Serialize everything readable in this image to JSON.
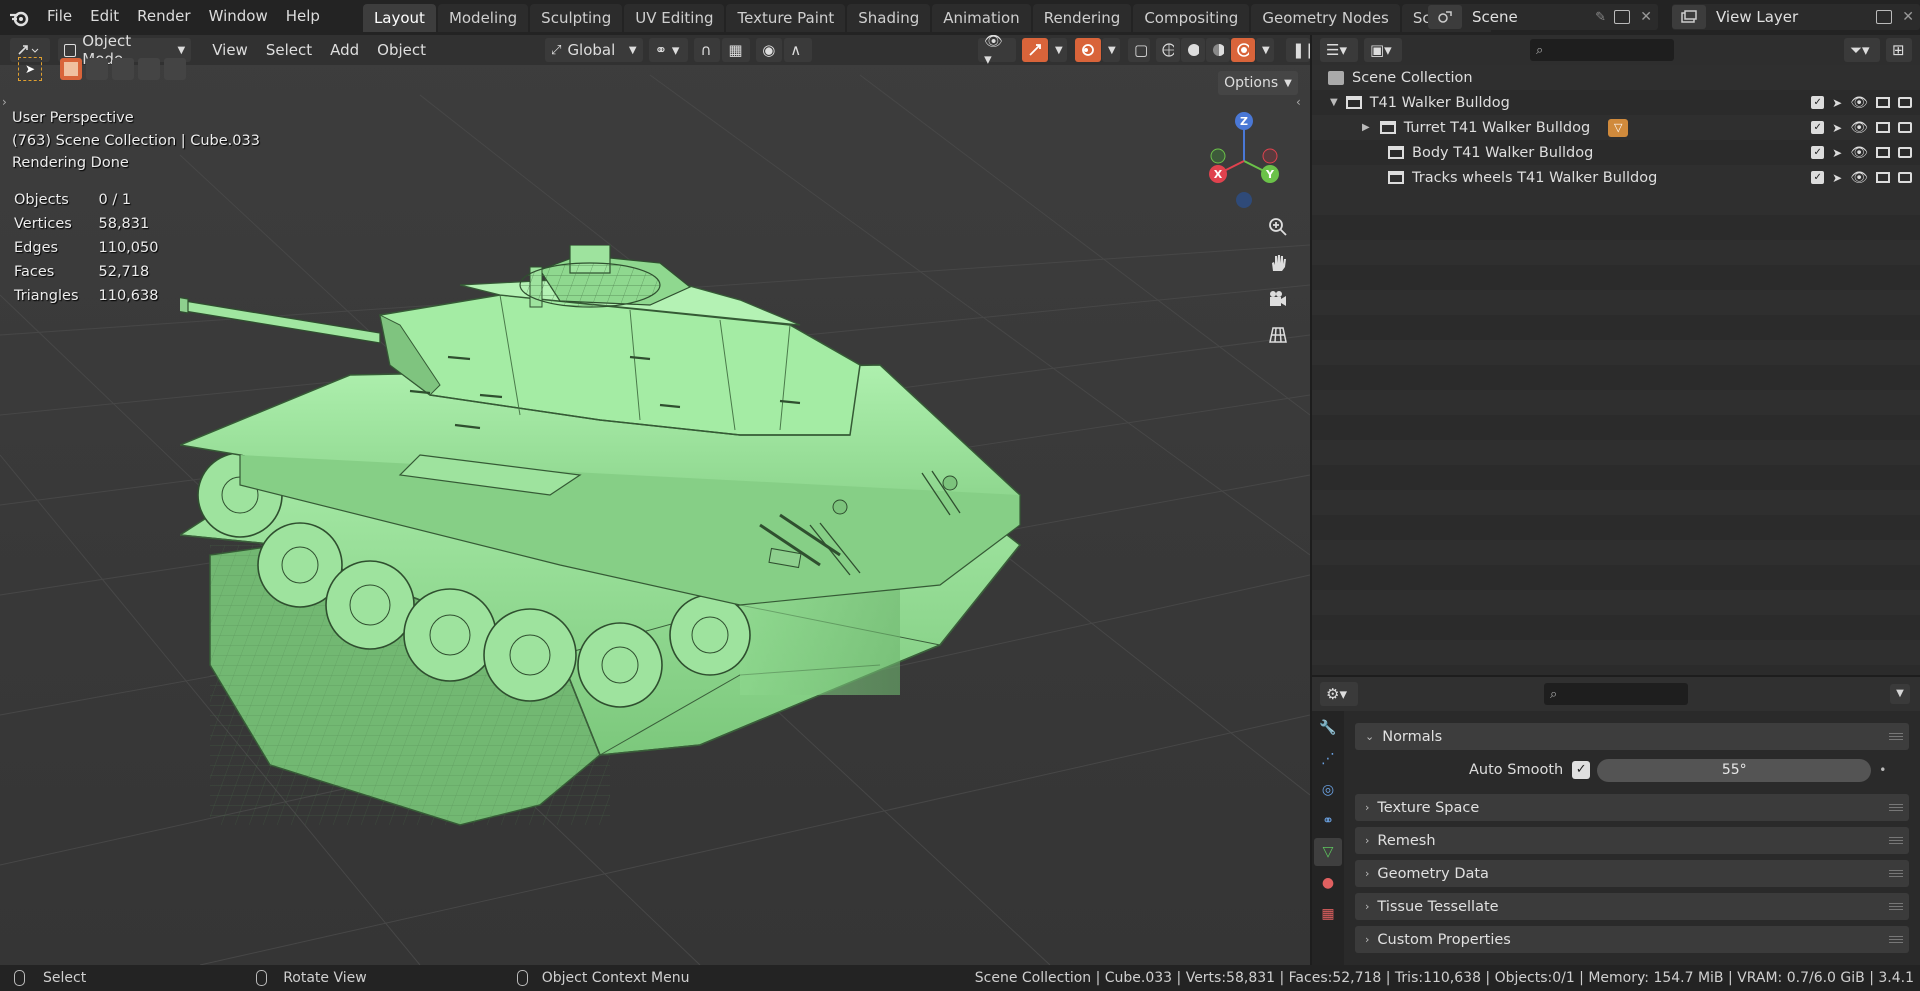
{
  "topbar": {
    "menus": [
      "File",
      "Edit",
      "Render",
      "Window",
      "Help"
    ],
    "workspaces": [
      "Layout",
      "Modeling",
      "Sculpting",
      "UV Editing",
      "Texture Paint",
      "Shading",
      "Animation",
      "Rendering",
      "Compositing",
      "Geometry Nodes",
      "Scripting"
    ],
    "active_workspace": "Layout",
    "scene_name": "Scene",
    "view_layer": "View Layer"
  },
  "viewport": {
    "mode": "Object Mode",
    "menus": [
      "View",
      "Select",
      "Add",
      "Object"
    ],
    "orientation": "Global",
    "options_label": "Options",
    "overlay_lines": [
      "User Perspective",
      "(763) Scene Collection | Cube.033",
      "Rendering Done"
    ],
    "stats": [
      {
        "label": "Objects",
        "value": "0 / 1"
      },
      {
        "label": "Vertices",
        "value": "58,831"
      },
      {
        "label": "Edges",
        "value": "110,050"
      },
      {
        "label": "Faces",
        "value": "52,718"
      },
      {
        "label": "Triangles",
        "value": "110,638"
      }
    ],
    "gizmo": {
      "z": "Z",
      "y": "Y",
      "x": "X"
    }
  },
  "outliner": {
    "root": "Scene Collection",
    "collection": "T41 Walker Bulldog",
    "children": [
      "Turret T41 Walker Bulldog",
      "Body T41 Walker Bulldog",
      "Tracks wheels T41 Walker Bulldog"
    ]
  },
  "properties": {
    "panels": {
      "normals": "Normals",
      "auto_smooth_label": "Auto Smooth",
      "auto_smooth_angle": "55°",
      "texture_space": "Texture Space",
      "remesh": "Remesh",
      "geometry_data": "Geometry Data",
      "tissue_tessellate": "Tissue Tessellate",
      "custom_properties": "Custom Properties"
    }
  },
  "statusbar": {
    "select": "Select",
    "rotate": "Rotate View",
    "context": "Object Context Menu",
    "info": "Scene Collection | Cube.033 | Verts:58,831 | Faces:52,718 | Tris:110,638 | Objects:0/1 | Memory: 154.7 MiB | VRAM: 0.7/6.0 GiB | 3.4.1"
  },
  "colors": {
    "accent": "#4772b3",
    "mesh": "#8fdc8f",
    "active_orange": "#e07a3c"
  }
}
